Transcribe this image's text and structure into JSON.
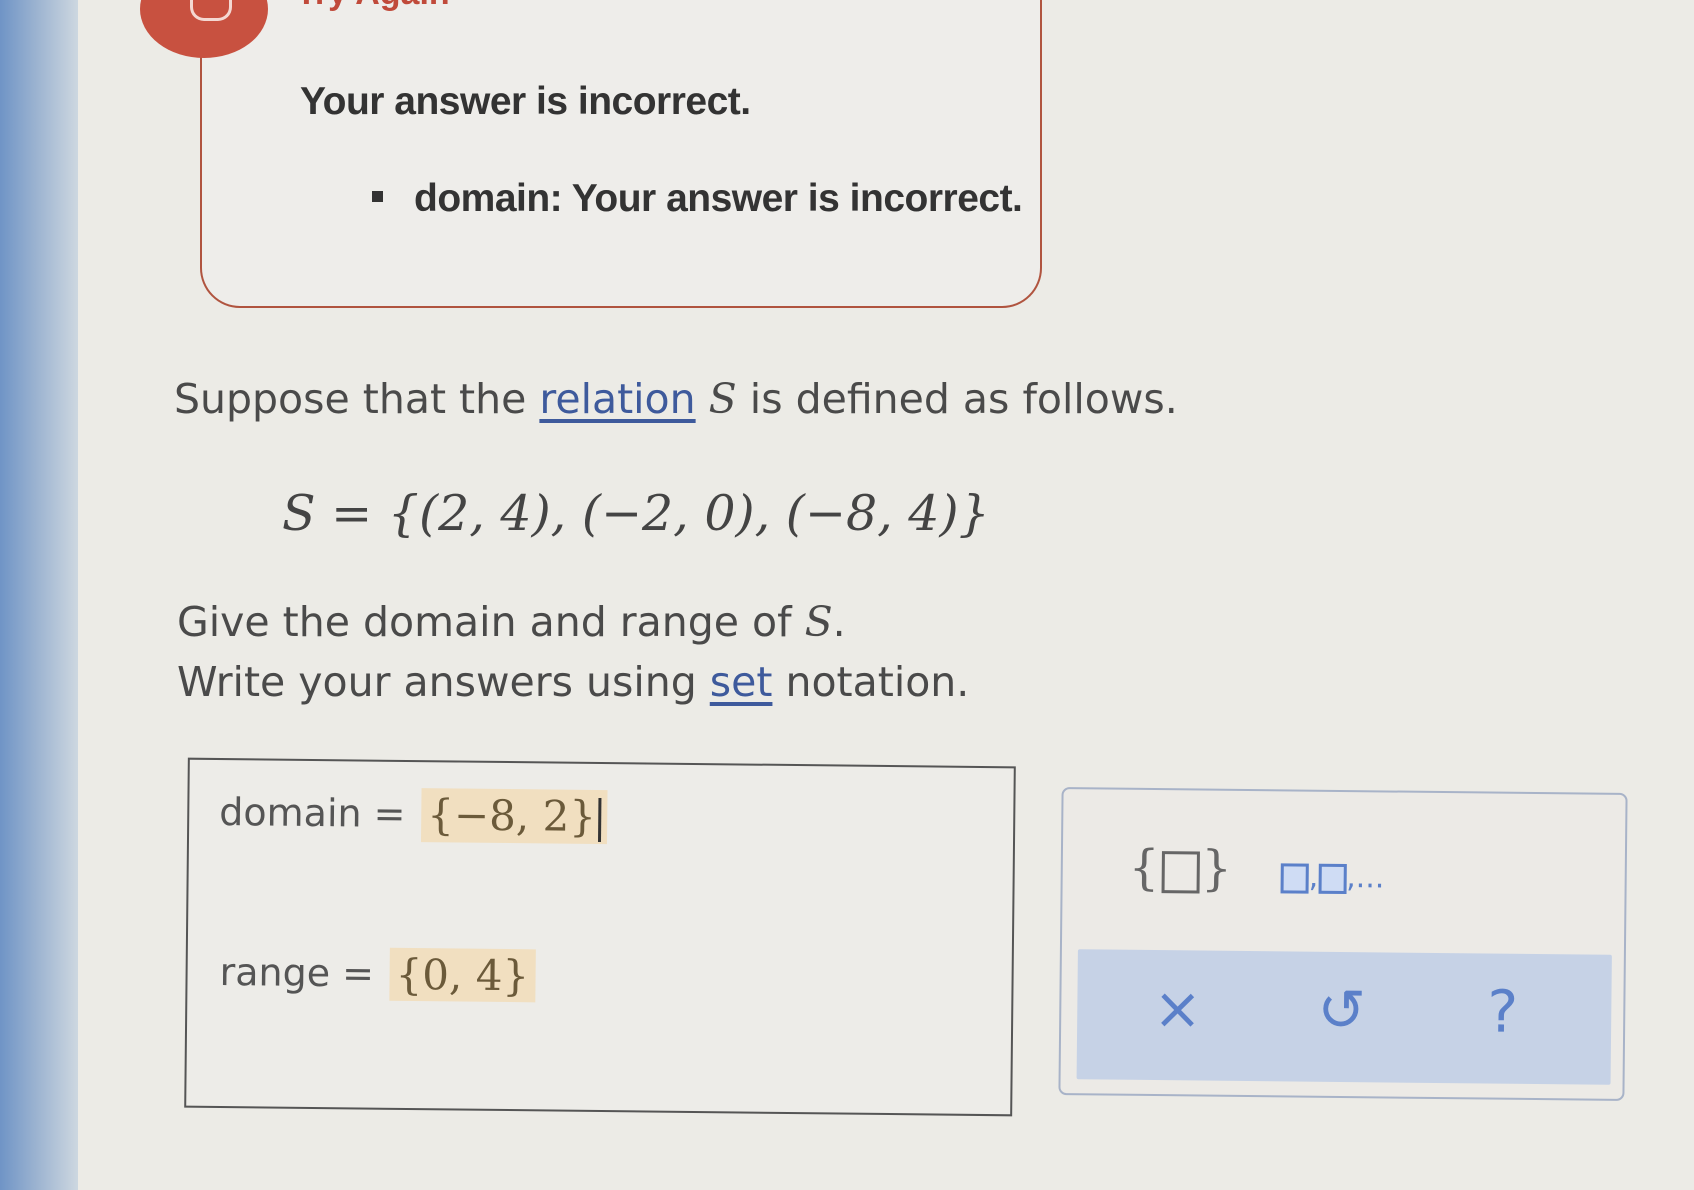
{
  "feedback": {
    "title": "Try Again",
    "message": "Your answer is incorrect.",
    "items": [
      {
        "text": "domain: Your answer is incorrect."
      }
    ]
  },
  "problem": {
    "intro_before": "Suppose that the ",
    "relation_link": "relation",
    "symbol": "S",
    "intro_after": " is defined as follows.",
    "set_definition": "S = {(2, 4), (−2, 0), (−8, 4)}",
    "question_line1_before": "Give the domain and range of ",
    "question_line1_after": ".",
    "question_line2_before": "Write your answers using ",
    "set_link": "set",
    "question_line2_after": " notation."
  },
  "answer": {
    "domain_label": "domain  =",
    "domain_value": "{−8, 2}",
    "range_label": "range  =",
    "range_value": "{0, 4}"
  },
  "keypad": {
    "set_brace_open": "{",
    "set_brace_close": "}",
    "list_separator": ",",
    "list_ellipsis": ",...",
    "clear_label": "×",
    "undo_label": "↺",
    "help_label": "?"
  }
}
